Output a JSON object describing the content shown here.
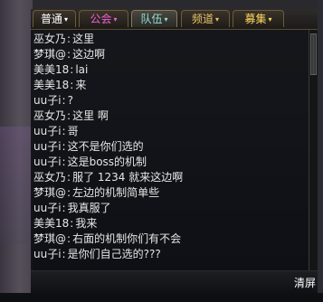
{
  "tabs": [
    {
      "label": "普通",
      "active": false,
      "color": "#ffffff"
    },
    {
      "label": "公会",
      "active": false,
      "color": "#f060d8"
    },
    {
      "label": "队伍",
      "active": true,
      "color": "#8fe0d8"
    },
    {
      "label": "频道",
      "active": false,
      "color": "#e8c36a"
    },
    {
      "label": "募集",
      "active": false,
      "color": "#ffd860"
    }
  ],
  "tab_arrow": "▾",
  "messages": [
    {
      "sender": "巫女乃",
      "sep": ":",
      "text": "这里"
    },
    {
      "sender": "梦琪@",
      "sep": ":",
      "text": "这边啊"
    },
    {
      "sender": "美美18",
      "sep": ":",
      "text": "lai"
    },
    {
      "sender": "美美18",
      "sep": ":",
      "text": "来"
    },
    {
      "sender": "uu子i",
      "sep": ":",
      "text": "?"
    },
    {
      "sender": "巫女乃",
      "sep": ":",
      "text": "这里 啊"
    },
    {
      "sender": "uu子i",
      "sep": ":",
      "text": "哥"
    },
    {
      "sender": "uu子i",
      "sep": ":",
      "text": "这不是你们选的"
    },
    {
      "sender": "uu子i",
      "sep": ":",
      "text": "这是boss的机制"
    },
    {
      "sender": "巫女乃",
      "sep": ":",
      "text": "服了  1234  就来这边啊"
    },
    {
      "sender": "梦琪@",
      "sep": ":",
      "text": "左边的机制简单些"
    },
    {
      "sender": "uu子i",
      "sep": ":",
      "text": "我真服了"
    },
    {
      "sender": "美美18",
      "sep": ":",
      "text": "我来"
    },
    {
      "sender": "梦琪@",
      "sep": ":",
      "text": "右面的机制你们有不会"
    },
    {
      "sender": "uu子i",
      "sep": ":",
      "text": "是你们自己选的???"
    }
  ],
  "clear_label": "清屏"
}
